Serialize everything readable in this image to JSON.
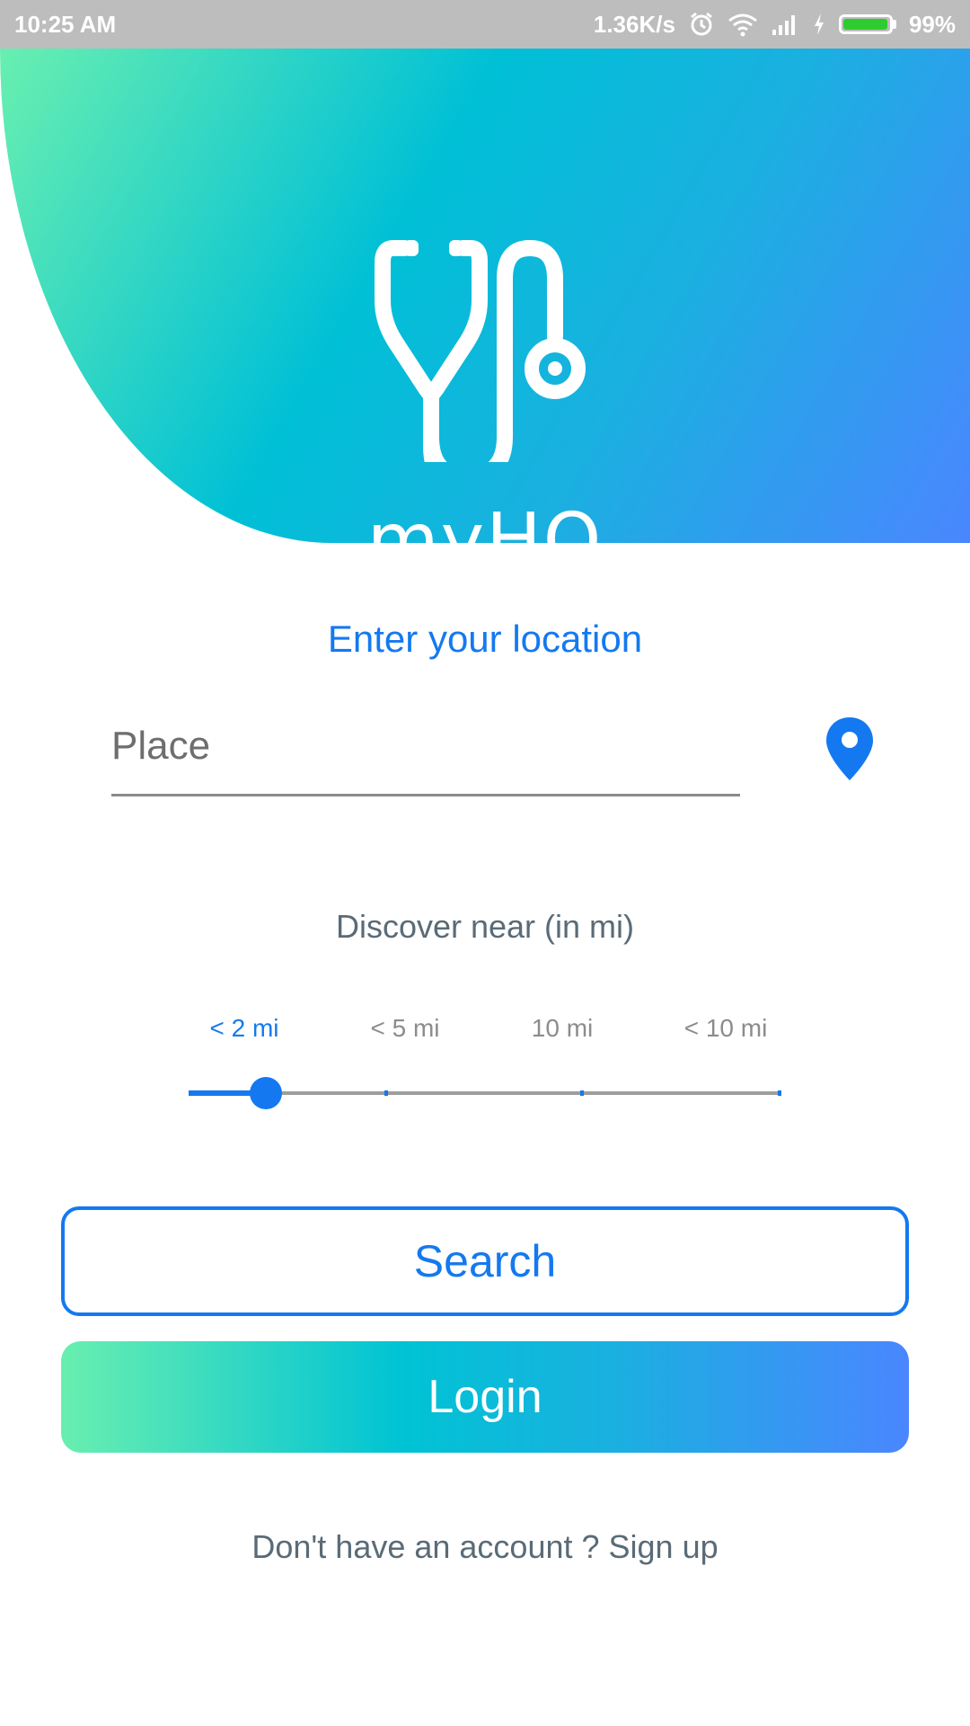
{
  "status_bar": {
    "time": "10:25 AM",
    "speed": "1.36K/s",
    "battery": "99%",
    "battery_level": 0.99,
    "icons": [
      "alarm-icon",
      "wifi-icon",
      "signal-icon",
      "charging-icon",
      "battery-icon"
    ]
  },
  "header": {
    "brand": "myHQ",
    "logo_icon": "stethoscope-icon"
  },
  "location": {
    "title": "Enter your location",
    "place_placeholder": "Place",
    "place_value": "",
    "pin_icon": "location-pin-icon"
  },
  "discover": {
    "title": "Discover near (in mi)",
    "options": [
      "< 2 mi",
      "< 5 mi",
      "10 mi",
      "< 10 mi"
    ],
    "selected_index": 0,
    "slider_value": 0.13
  },
  "buttons": {
    "search": "Search",
    "login": "Login"
  },
  "footer": {
    "signup": "Don't have an account ? Sign up"
  },
  "colors": {
    "accent": "#1479f0",
    "gradient_start": "#69efb0",
    "gradient_mid": "#00c0d6",
    "gradient_end": "#4a86ff",
    "status_bar": "#bdbdbd",
    "muted_text": "#5a6b77"
  }
}
